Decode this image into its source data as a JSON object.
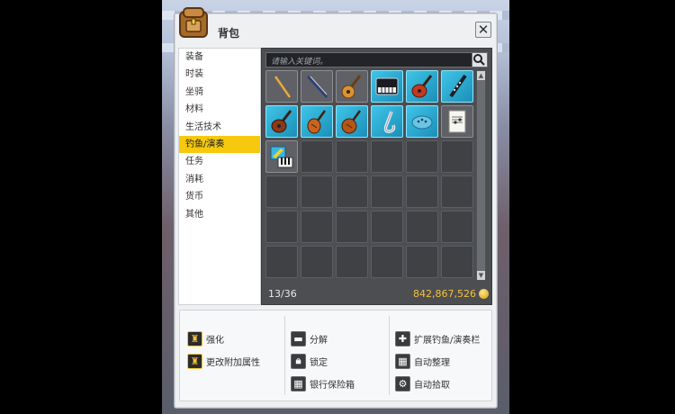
{
  "window": {
    "title": "背包",
    "close_glyph": "✕"
  },
  "categories": [
    "装备",
    "时装",
    "坐骑",
    "材料",
    "生活技术",
    "钓鱼/演奏",
    "任务",
    "消耗",
    "货币",
    "其他"
  ],
  "active_category_index": 5,
  "search": {
    "placeholder": "请输入关键词。"
  },
  "items": [
    {
      "icon": "flute-stick-icon",
      "highlight": false
    },
    {
      "icon": "violin-bow-icon",
      "highlight": false
    },
    {
      "icon": "acoustic-guitar-icon",
      "highlight": false
    },
    {
      "icon": "piano-icon",
      "highlight": true
    },
    {
      "icon": "electric-guitar-icon",
      "highlight": true
    },
    {
      "icon": "clarinet-icon",
      "highlight": true
    },
    {
      "icon": "bass-guitar-icon",
      "highlight": true
    },
    {
      "icon": "violin-icon",
      "highlight": true
    },
    {
      "icon": "cello-icon",
      "highlight": true
    },
    {
      "icon": "saxophone-icon",
      "highlight": true
    },
    {
      "icon": "ocarina-icon",
      "highlight": true
    },
    {
      "icon": "sheet-music-icon",
      "highlight": false
    },
    {
      "icon": "keyboard-synth-icon",
      "highlight": false
    }
  ],
  "footer": {
    "slots_used": "13/36",
    "money": "842,867,526"
  },
  "actions": {
    "col1": [
      {
        "label": "强化",
        "icon": "upgrade-anvil-icon"
      },
      {
        "label": "更改附加属性",
        "icon": "change-attribute-icon"
      }
    ],
    "col2": [
      {
        "label": "分解",
        "icon": "disassemble-icon"
      },
      {
        "label": "锁定",
        "icon": "lock-icon"
      },
      {
        "label": "银行保险箱",
        "icon": "bank-safe-icon"
      }
    ],
    "col3": [
      {
        "label": "扩展钓鱼/演奏栏",
        "icon": "expand-plus-icon"
      },
      {
        "label": "自动整理",
        "icon": "auto-sort-icon"
      },
      {
        "label": "自动拾取",
        "icon": "auto-pickup-gear-icon"
      }
    ]
  }
}
